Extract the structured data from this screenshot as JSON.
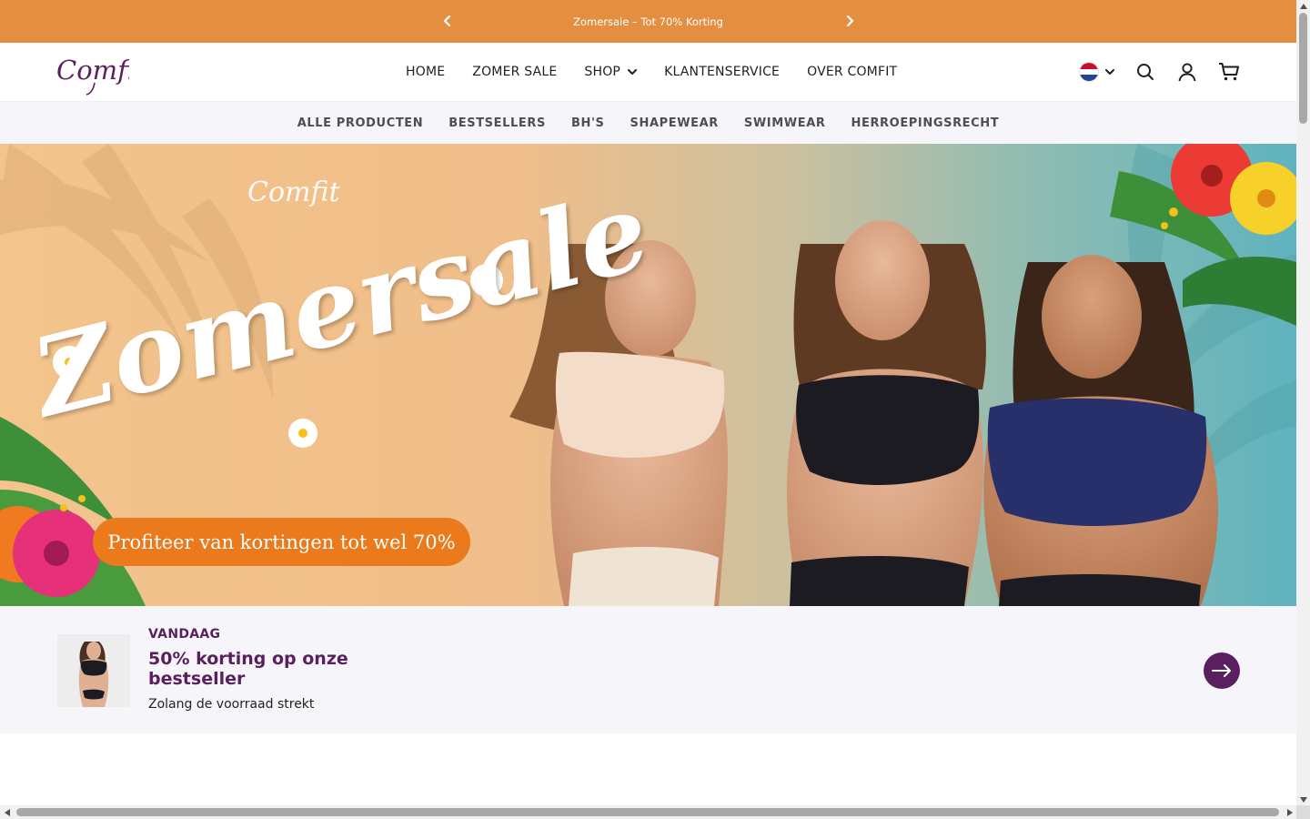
{
  "announcement": {
    "message": "Zomersale – Tot 70% Korting",
    "prev_icon": "chevron-left-icon",
    "next_icon": "chevron-right-icon",
    "background": "#e48e41"
  },
  "header": {
    "logo_text": "Comfit",
    "nav": [
      {
        "label": "HOME"
      },
      {
        "label": "ZOMER SALE"
      },
      {
        "label": "SHOP",
        "has_dropdown": true
      },
      {
        "label": "KLANTENSERVICE"
      },
      {
        "label": "OVER COMFIT"
      }
    ],
    "icons": [
      "netherlands-flag-icon",
      "chevron-down-icon",
      "search-icon",
      "account-icon",
      "cart-icon"
    ]
  },
  "subnav": {
    "items": [
      {
        "label": "ALLE PRODUCTEN"
      },
      {
        "label": "BESTSELLERS"
      },
      {
        "label": "BH'S"
      },
      {
        "label": "SHAPEWEAR"
      },
      {
        "label": "SWIMWEAR"
      },
      {
        "label": "HERROEPINGSRECHT"
      }
    ]
  },
  "hero": {
    "brand": "Comfit",
    "headline": "Zomersale",
    "badge": "Profiteer van kortingen tot wel 70%",
    "badge_color": "#ea7a1c"
  },
  "promo": {
    "eyebrow": "VANDAAG",
    "title": "50% korting op onze bestseller",
    "subtitle": "Zolang de voorraad strekt",
    "cta_icon": "arrow-right-icon",
    "accent": "#5a1f5e"
  }
}
